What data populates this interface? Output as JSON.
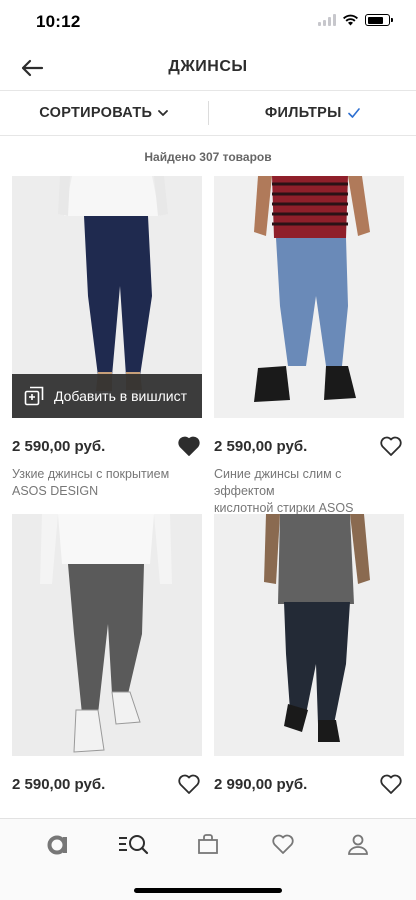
{
  "status": {
    "time": "10:12",
    "battery_level": 0.75
  },
  "header": {
    "title": "ДЖИНСЫ",
    "back_icon": "arrow-left-icon"
  },
  "toolbar": {
    "sort_label": "СОРТИРОВАТЬ",
    "filter_label": "ФИЛЬТРЫ"
  },
  "results": {
    "count_text": "Найдено 307 товаров"
  },
  "wishlist_overlay": {
    "label": "Добавить в вишлист"
  },
  "products": [
    {
      "price": "2 590,00 руб.",
      "desc_line1": "Узкие джинсы с покрытием",
      "desc_line2": "ASOS DESIGN",
      "favorited": true
    },
    {
      "price": "2 590,00 руб.",
      "desc_line1": "Синие джинсы слим с эффектом",
      "desc_line2": "кислотной стирки ASOS DESIGN",
      "favorited": false
    },
    {
      "price": "2 590,00 руб.",
      "desc_line1": "",
      "desc_line2": "",
      "favorited": false
    },
    {
      "price": "2 990,00 руб.",
      "desc_line1": "",
      "desc_line2": "",
      "favorited": false
    }
  ],
  "nav": {
    "items": [
      {
        "icon": "asos-logo-icon"
      },
      {
        "icon": "search-browse-icon"
      },
      {
        "icon": "bag-icon"
      },
      {
        "icon": "heart-icon"
      },
      {
        "icon": "account-icon"
      }
    ]
  },
  "colors": {
    "text": "#2d2d2d",
    "muted": "#777777",
    "overlay": "#2d2d2d",
    "accent_check": "#2d6fd1"
  }
}
